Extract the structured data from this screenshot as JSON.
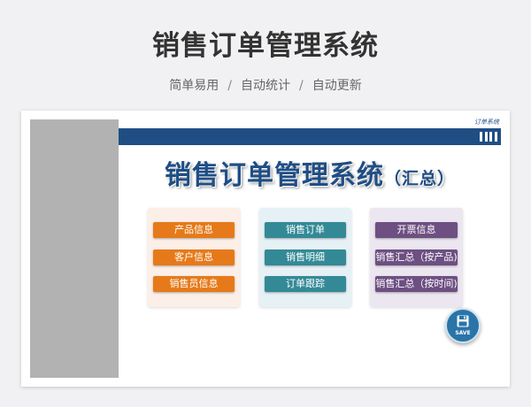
{
  "page": {
    "title": "销售订单管理系统",
    "subtitle_items": [
      "简单易用",
      "自动统计",
      "自动更新"
    ],
    "separator": "/"
  },
  "window": {
    "corner_text": "订单系统",
    "app_title": "销售订单管理系统",
    "app_title_suffix": "（汇总）",
    "groups": [
      {
        "color": "#e67a1a",
        "buttons": [
          "产品信息",
          "客户信息",
          "销售员信息"
        ]
      },
      {
        "color": "#338a96",
        "buttons": [
          "销售订单",
          "销售明细",
          "订单跟踪"
        ]
      },
      {
        "color": "#6d4f82",
        "buttons": [
          "开票信息",
          "销售汇总（按产品)",
          "销售汇总（按时间)"
        ]
      }
    ],
    "save_label": "SAVE",
    "save_icon": "floppy-disk-icon",
    "menu_icon": "bars-icon"
  }
}
